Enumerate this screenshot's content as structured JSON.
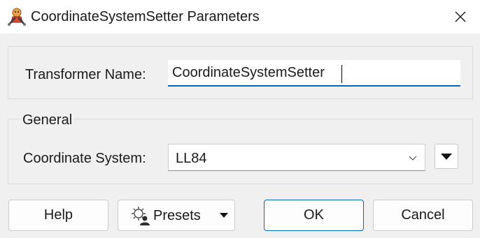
{
  "window": {
    "title": "CoordinateSystemSetter Parameters",
    "app_icon": "fme-transformer-icon",
    "close_icon": "close-icon"
  },
  "name_section": {
    "label": "Transformer Name:",
    "value": "CoordinateSystemSetter"
  },
  "general_section": {
    "heading": "General",
    "coordinate_system": {
      "label": "Coordinate System:",
      "value": "LL84",
      "chevron_icon": "chevron-down-icon",
      "menu_icon": "triangle-down-icon"
    }
  },
  "buttons": {
    "help": "Help",
    "presets": "Presets",
    "presets_icon": "gear-user-icon",
    "ok": "OK",
    "cancel": "Cancel"
  },
  "colors": {
    "accent": "#0067c0",
    "background": "#f0f0f0"
  }
}
